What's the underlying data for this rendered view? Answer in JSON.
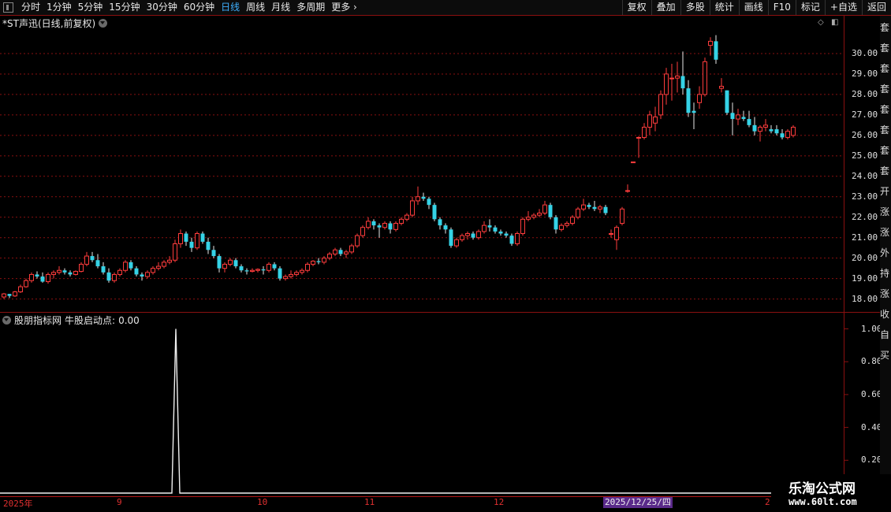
{
  "toolbar": {
    "periods": [
      {
        "label": "分时",
        "active": false
      },
      {
        "label": "1分钟",
        "active": false
      },
      {
        "label": "5分钟",
        "active": false
      },
      {
        "label": "15分钟",
        "active": false
      },
      {
        "label": "30分钟",
        "active": false
      },
      {
        "label": "60分钟",
        "active": false
      },
      {
        "label": "日线",
        "active": true
      },
      {
        "label": "周线",
        "active": false
      },
      {
        "label": "月线",
        "active": false
      },
      {
        "label": "多周期",
        "active": false
      },
      {
        "label": "更多",
        "active": false
      }
    ],
    "buttons": [
      "复权",
      "叠加",
      "多股",
      "统计",
      "画线",
      "F10",
      "标记",
      "+自选",
      "返回"
    ]
  },
  "stock": {
    "title": "*ST声迅(日线,前复权)"
  },
  "indicator": {
    "title": "股朋指标网",
    "signal_label": "牛股启动点:",
    "signal_value": "0.00"
  },
  "price_axis": [
    "30.00",
    "29.00",
    "28.00",
    "27.00",
    "26.00",
    "25.00",
    "24.00",
    "23.00",
    "22.00",
    "21.00",
    "20.00",
    "19.00",
    "18.00"
  ],
  "indicator_axis": [
    "1.00",
    "0.80",
    "0.60",
    "0.40",
    "0.20"
  ],
  "date_axis": {
    "labels": [
      "2025年",
      "9",
      "10",
      "11",
      "12",
      "2"
    ],
    "highlight": "2025/12/25/四"
  },
  "watermark": {
    "line1": "乐淘公式网",
    "line2": "www.60lt.com"
  },
  "sidebar_text": [
    "套",
    "套",
    "套",
    "套",
    "套",
    "套",
    "套",
    "套",
    "开",
    "涨",
    "涨",
    "外",
    "持",
    "涨",
    "收",
    "自",
    "买"
  ],
  "colors": {
    "up": "#ff3c3c",
    "down": "#35d2e6",
    "grid": "#8a1010",
    "active_tab": "#3fb0ff",
    "date_highlight": "#5a2a8a"
  },
  "chart_data": [
    {
      "type": "candlestick",
      "title": "*ST声迅(日线,前复权)",
      "ylim": [
        17.6,
        31.0
      ],
      "bars": [
        [
          18.1,
          18.3,
          18.0,
          18.25
        ],
        [
          18.25,
          18.25,
          18.05,
          18.15
        ],
        [
          18.15,
          18.4,
          18.1,
          18.35
        ],
        [
          18.35,
          18.7,
          18.3,
          18.6
        ],
        [
          18.6,
          19.0,
          18.55,
          18.9
        ],
        [
          18.9,
          19.3,
          18.8,
          19.2
        ],
        [
          19.2,
          19.35,
          19.0,
          19.1
        ],
        [
          19.1,
          19.3,
          18.8,
          18.85
        ],
        [
          18.85,
          19.3,
          18.75,
          19.2
        ],
        [
          19.2,
          19.4,
          19.0,
          19.3
        ],
        [
          19.3,
          19.6,
          19.2,
          19.4
        ],
        [
          19.4,
          19.5,
          19.2,
          19.3
        ],
        [
          19.3,
          19.4,
          19.1,
          19.2
        ],
        [
          19.2,
          19.4,
          19.15,
          19.35
        ],
        [
          19.35,
          19.8,
          19.3,
          19.7
        ],
        [
          19.7,
          20.3,
          19.6,
          20.1
        ],
        [
          20.1,
          20.3,
          19.8,
          19.9
        ],
        [
          19.9,
          20.2,
          19.5,
          19.6
        ],
        [
          19.6,
          19.8,
          19.2,
          19.3
        ],
        [
          19.3,
          19.5,
          18.8,
          18.9
        ],
        [
          18.9,
          19.3,
          18.8,
          19.2
        ],
        [
          19.2,
          19.5,
          19.1,
          19.4
        ],
        [
          19.4,
          19.9,
          19.3,
          19.8
        ],
        [
          19.8,
          19.9,
          19.4,
          19.5
        ],
        [
          19.5,
          19.6,
          19.1,
          19.2
        ],
        [
          19.2,
          19.3,
          18.9,
          19.1
        ],
        [
          19.1,
          19.4,
          19.0,
          19.3
        ],
        [
          19.3,
          19.6,
          19.2,
          19.5
        ],
        [
          19.5,
          19.8,
          19.4,
          19.6
        ],
        [
          19.6,
          19.9,
          19.5,
          19.8
        ],
        [
          19.8,
          20.1,
          19.7,
          19.9
        ],
        [
          19.9,
          20.9,
          19.8,
          20.7
        ],
        [
          20.7,
          21.4,
          20.5,
          21.2
        ],
        [
          21.2,
          21.3,
          20.6,
          20.8
        ],
        [
          20.8,
          21.0,
          20.3,
          20.5
        ],
        [
          20.5,
          21.3,
          20.4,
          21.2
        ],
        [
          21.2,
          21.3,
          20.7,
          20.8
        ],
        [
          20.8,
          21.0,
          20.2,
          20.4
        ],
        [
          20.4,
          20.6,
          20.0,
          20.1
        ],
        [
          20.1,
          20.2,
          19.3,
          19.5
        ],
        [
          19.5,
          19.8,
          19.3,
          19.7
        ],
        [
          19.7,
          20.0,
          19.6,
          19.9
        ],
        [
          19.9,
          20.0,
          19.5,
          19.6
        ],
        [
          19.6,
          19.7,
          19.3,
          19.4
        ],
        [
          19.4,
          19.5,
          19.2,
          19.35
        ],
        [
          19.35,
          19.5,
          19.3,
          19.4
        ],
        [
          19.4,
          19.5,
          19.3,
          19.45
        ],
        [
          19.45,
          19.6,
          19.2,
          19.4
        ],
        [
          19.4,
          19.8,
          19.3,
          19.7
        ],
        [
          19.7,
          19.8,
          19.4,
          19.5
        ],
        [
          19.5,
          19.6,
          18.9,
          19.0
        ],
        [
          19.0,
          19.2,
          18.9,
          19.1
        ],
        [
          19.1,
          19.4,
          19.0,
          19.2
        ],
        [
          19.2,
          19.4,
          19.1,
          19.3
        ],
        [
          19.3,
          19.5,
          19.2,
          19.4
        ],
        [
          19.4,
          19.8,
          19.3,
          19.7
        ],
        [
          19.7,
          19.9,
          19.6,
          19.85
        ],
        [
          19.85,
          20.0,
          19.7,
          19.8
        ],
        [
          19.8,
          20.1,
          19.7,
          20.0
        ],
        [
          20.0,
          20.3,
          19.9,
          20.2
        ],
        [
          20.2,
          20.5,
          20.1,
          20.4
        ],
        [
          20.4,
          20.5,
          20.1,
          20.2
        ],
        [
          20.2,
          20.4,
          20.0,
          20.3
        ],
        [
          20.3,
          20.7,
          20.2,
          20.6
        ],
        [
          20.6,
          21.2,
          20.5,
          21.1
        ],
        [
          21.1,
          21.6,
          21.0,
          21.5
        ],
        [
          21.5,
          22.0,
          21.4,
          21.8
        ],
        [
          21.8,
          21.9,
          21.4,
          21.6
        ],
        [
          21.6,
          21.7,
          21.0,
          21.5
        ],
        [
          21.5,
          21.8,
          21.4,
          21.7
        ],
        [
          21.7,
          21.8,
          21.2,
          21.4
        ],
        [
          21.4,
          21.8,
          21.3,
          21.7
        ],
        [
          21.7,
          22.0,
          21.6,
          21.9
        ],
        [
          21.9,
          22.2,
          21.8,
          22.1
        ],
        [
          22.1,
          23.0,
          22.0,
          22.8
        ],
        [
          22.8,
          23.5,
          22.6,
          23.0
        ],
        [
          23.0,
          23.2,
          22.8,
          22.9
        ],
        [
          22.9,
          23.0,
          22.4,
          22.6
        ],
        [
          22.6,
          22.7,
          21.8,
          21.9
        ],
        [
          21.9,
          22.0,
          21.4,
          21.6
        ],
        [
          21.6,
          21.7,
          21.2,
          21.4
        ],
        [
          21.4,
          21.5,
          20.5,
          20.6
        ],
        [
          20.6,
          21.0,
          20.5,
          20.9
        ],
        [
          20.9,
          21.2,
          20.8,
          21.1
        ],
        [
          21.1,
          21.3,
          20.9,
          21.2
        ],
        [
          21.2,
          21.3,
          20.9,
          21.0
        ],
        [
          21.0,
          21.4,
          20.9,
          21.3
        ],
        [
          21.3,
          21.8,
          21.2,
          21.6
        ],
        [
          21.6,
          21.9,
          21.3,
          21.5
        ],
        [
          21.5,
          21.6,
          21.2,
          21.3
        ],
        [
          21.3,
          21.4,
          21.1,
          21.2
        ],
        [
          21.2,
          21.3,
          21.0,
          21.1
        ],
        [
          21.1,
          21.2,
          20.6,
          20.7
        ],
        [
          20.7,
          21.3,
          20.6,
          21.2
        ],
        [
          21.2,
          22.0,
          21.1,
          21.9
        ],
        [
          21.9,
          22.3,
          21.8,
          22.0
        ],
        [
          22.0,
          22.2,
          21.9,
          22.1
        ],
        [
          22.1,
          22.4,
          22.0,
          22.2
        ],
        [
          22.2,
          22.8,
          22.1,
          22.6
        ],
        [
          22.6,
          22.7,
          21.9,
          22.0
        ],
        [
          22.0,
          22.1,
          21.2,
          21.4
        ],
        [
          21.4,
          21.7,
          21.3,
          21.6
        ],
        [
          21.6,
          21.8,
          21.5,
          21.7
        ],
        [
          21.7,
          22.1,
          21.6,
          22.0
        ],
        [
          22.0,
          22.5,
          21.9,
          22.4
        ],
        [
          22.4,
          22.9,
          22.3,
          22.6
        ],
        [
          22.6,
          22.7,
          22.4,
          22.5
        ],
        [
          22.5,
          22.8,
          22.3,
          22.4
        ],
        [
          22.4,
          22.6,
          22.2,
          22.5
        ],
        [
          22.5,
          22.6,
          22.1,
          22.2
        ],
        [
          21.2,
          21.4,
          21.0,
          21.2
        ],
        [
          20.9,
          21.6,
          20.4,
          21.5
        ],
        [
          21.7,
          22.5,
          21.6,
          22.4
        ],
        [
          23.3,
          23.6,
          23.2,
          23.3
        ],
        [
          24.7,
          24.7,
          24.7,
          24.7
        ],
        [
          25.9,
          25.95,
          24.9,
          25.9
        ],
        [
          25.9,
          26.6,
          25.8,
          26.4
        ],
        [
          26.4,
          27.2,
          26.0,
          27.0
        ],
        [
          26.6,
          27.4,
          26.2,
          26.9
        ],
        [
          27.0,
          28.2,
          26.8,
          28.0
        ],
        [
          28.0,
          29.3,
          27.5,
          29.0
        ],
        [
          28.8,
          29.5,
          27.7,
          28.8
        ],
        [
          28.8,
          29.6,
          28.1,
          28.9
        ],
        [
          28.9,
          30.1,
          28.0,
          28.3
        ],
        [
          28.3,
          28.7,
          26.9,
          27.1
        ],
        [
          27.2,
          27.6,
          26.3,
          27.1
        ],
        [
          27.6,
          28.4,
          27.3,
          28.0
        ],
        [
          28.0,
          29.8,
          27.9,
          29.6
        ],
        [
          30.4,
          30.8,
          29.9,
          30.6
        ],
        [
          30.6,
          30.9,
          29.5,
          29.7
        ],
        [
          28.3,
          28.8,
          28.1,
          28.4
        ],
        [
          28.2,
          28.2,
          27.0,
          27.1
        ],
        [
          27.1,
          27.6,
          26.0,
          26.8
        ],
        [
          26.8,
          27.3,
          26.5,
          27.0
        ],
        [
          26.9,
          27.2,
          26.7,
          26.8
        ],
        [
          26.8,
          27.2,
          26.4,
          26.5
        ],
        [
          26.5,
          26.9,
          26.0,
          26.2
        ],
        [
          26.2,
          26.5,
          25.7,
          26.4
        ],
        [
          26.4,
          26.8,
          26.2,
          26.5
        ],
        [
          26.3,
          26.5,
          26.1,
          26.2
        ],
        [
          26.3,
          26.5,
          26.0,
          26.1
        ],
        [
          26.1,
          26.3,
          25.8,
          25.9
        ],
        [
          25.9,
          26.3,
          25.8,
          26.2
        ],
        [
          26.0,
          26.5,
          25.9,
          26.4
        ]
      ]
    },
    {
      "type": "line",
      "title": "股朋指标网 牛股启动点",
      "ylim": [
        0,
        1.06
      ],
      "spike_index": 31,
      "values_note_free": true
    }
  ]
}
